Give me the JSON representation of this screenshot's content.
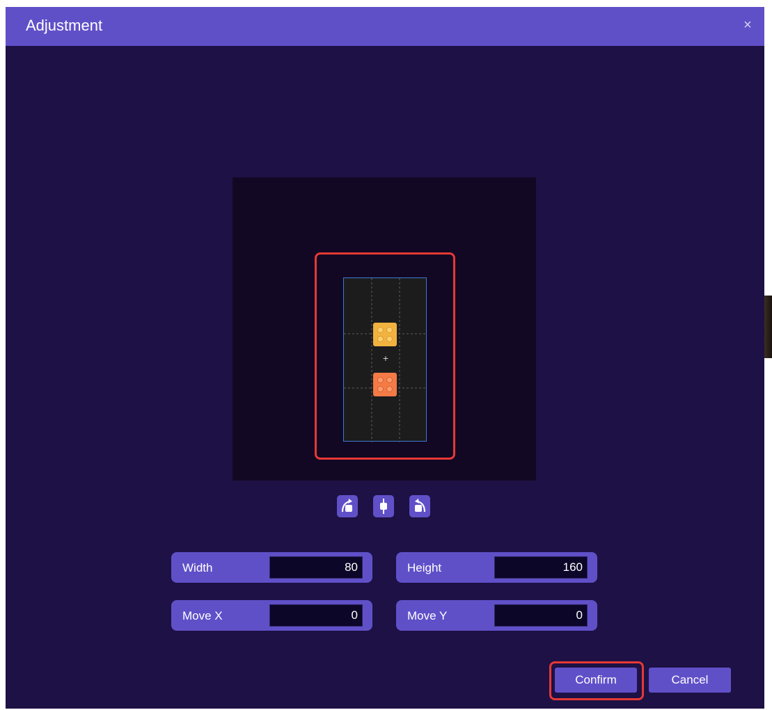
{
  "dialog": {
    "title": "Adjustment",
    "close_glyph": "×"
  },
  "preview": {
    "center_mark": "+",
    "bricks": [
      {
        "color_name": "yellow",
        "color": "#f2b23f"
      },
      {
        "color_name": "orange",
        "color": "#f47a46"
      }
    ],
    "icons": [
      "rotate-left-icon",
      "flip-icon",
      "rotate-right-icon"
    ]
  },
  "fields": {
    "width": {
      "label": "Width",
      "value": "80"
    },
    "height": {
      "label": "Height",
      "value": "160"
    },
    "move_x": {
      "label": "Move X",
      "value": "0"
    },
    "move_y": {
      "label": "Move Y",
      "value": "0"
    }
  },
  "actions": {
    "confirm_label": "Confirm",
    "cancel_label": "Cancel"
  },
  "colors": {
    "accent": "#6050c8",
    "background": "#1e1145",
    "highlight": "#e53935"
  }
}
